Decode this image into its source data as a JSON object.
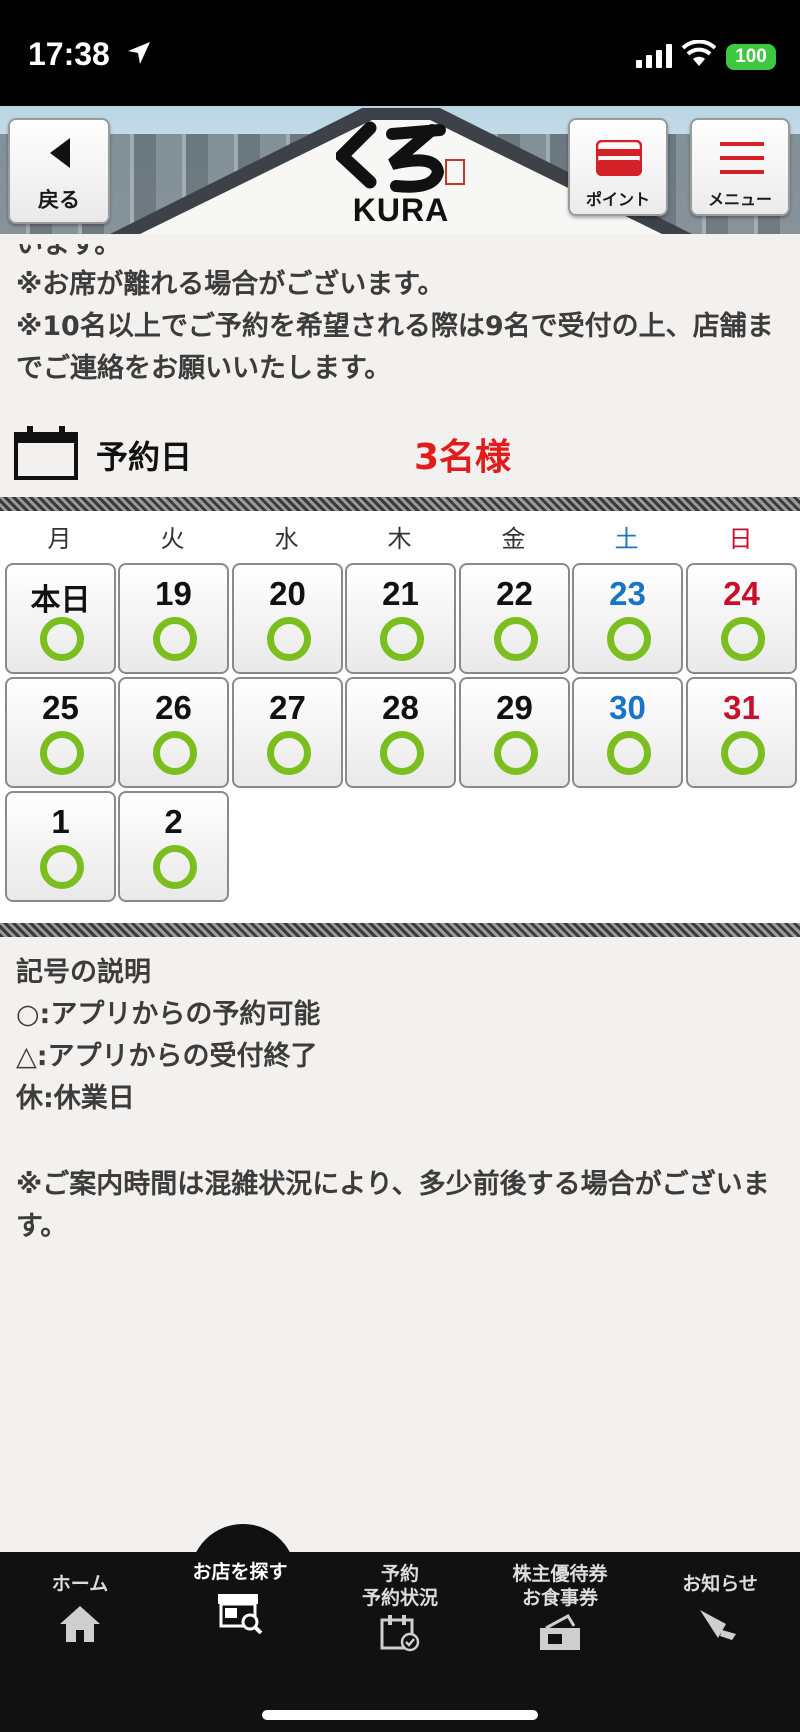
{
  "status_bar": {
    "time": "17:38",
    "battery": "100"
  },
  "header": {
    "back_label": "戻る",
    "logo_text": "KURA",
    "point_label": "ポイント",
    "menu_label": "メニュー"
  },
  "intro": {
    "cut_line": "います。",
    "lines": [
      "※お席が離れる場合がございます。",
      "※10名以上でご予約を希望される際は9名で受付の上、店舗までご連絡をお願いいたします。"
    ]
  },
  "reservation": {
    "label": "予約日",
    "party_size": "3名様"
  },
  "calendar": {
    "weekdays": [
      "月",
      "火",
      "水",
      "木",
      "金",
      "土",
      "日"
    ],
    "days": [
      {
        "label": "本日",
        "status": "○"
      },
      {
        "label": "19",
        "status": "○"
      },
      {
        "label": "20",
        "status": "○"
      },
      {
        "label": "21",
        "status": "○"
      },
      {
        "label": "22",
        "status": "○"
      },
      {
        "label": "23",
        "status": "○"
      },
      {
        "label": "24",
        "status": "○"
      },
      {
        "label": "25",
        "status": "○"
      },
      {
        "label": "26",
        "status": "○"
      },
      {
        "label": "27",
        "status": "○"
      },
      {
        "label": "28",
        "status": "○"
      },
      {
        "label": "29",
        "status": "○"
      },
      {
        "label": "30",
        "status": "○"
      },
      {
        "label": "31",
        "status": "○"
      },
      {
        "label": "1",
        "status": "○"
      },
      {
        "label": "2",
        "status": "○"
      }
    ],
    "colors": {
      "saturday": "#1a74c4",
      "sunday": "#c8102e",
      "available": "#7abf1f"
    }
  },
  "legend": {
    "title": "記号の説明",
    "items": [
      "○:アプリからの予約可能",
      "△:アプリからの受付終了",
      "休:休業日"
    ]
  },
  "notice": "※ご案内時間は混雑状況により、多少前後する場合がございます。",
  "tabbar": {
    "tabs": [
      {
        "label": "ホーム",
        "icon": "home-icon"
      },
      {
        "label": "お店を探す",
        "icon": "store-search-icon",
        "active": true
      },
      {
        "label": "予約\n予約状況",
        "icon": "calendar-check-icon"
      },
      {
        "label": "株主優待券\nお食事券",
        "icon": "ticket-icon"
      },
      {
        "label": "お知らせ",
        "icon": "megaphone-icon"
      }
    ]
  }
}
